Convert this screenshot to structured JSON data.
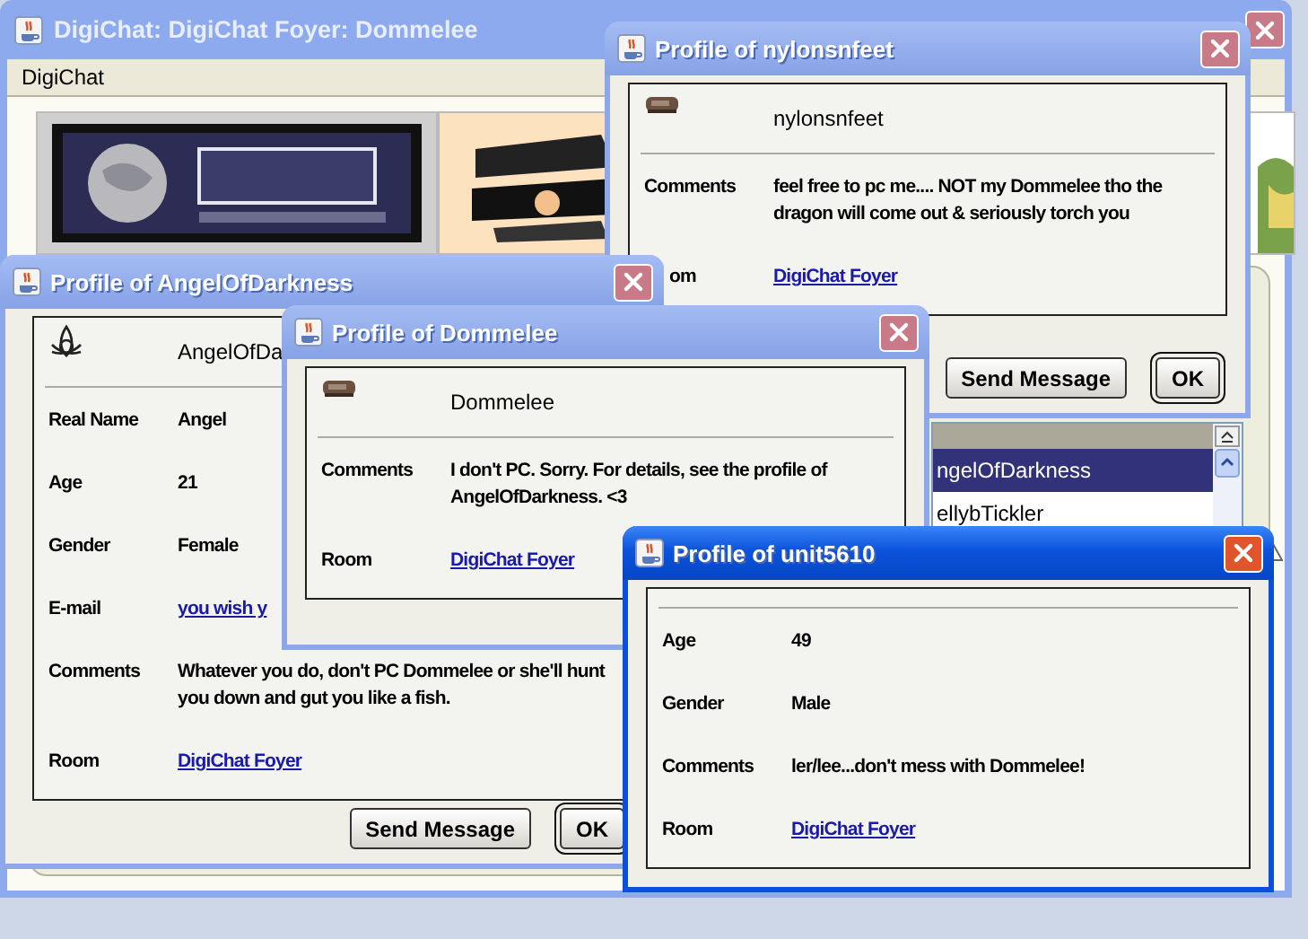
{
  "main_window": {
    "title": "DigiChat: DigiChat Foyer: Dommelee",
    "active": false,
    "menu": [
      {
        "label": "DigiChat"
      }
    ],
    "user_list": [
      {
        "name": "ngelOfDarkness",
        "selected": true
      },
      {
        "name": "ellybTickler",
        "selected": false
      }
    ]
  },
  "profile_windows": [
    {
      "title": "Profile of nylonsnfeet",
      "active": false,
      "avatar": {
        "kind": "thumbnail"
      },
      "username": "nylonsnfeet",
      "fields": [
        {
          "label": "Comments",
          "value": "feel free to pc me.... NOT my Dommelee tho the dragon will come out & seriously torch you",
          "kind": "text"
        },
        {
          "label": "om",
          "value": "DigiChat Foyer",
          "kind": "link"
        }
      ],
      "buttons": [
        {
          "label": "Send Message",
          "default": false
        },
        {
          "label": "OK",
          "default": true
        }
      ]
    },
    {
      "title": "Profile of AngelOfDarkness",
      "active": false,
      "avatar": {
        "kind": "triquetra"
      },
      "username": "AngelOfDa",
      "fields": [
        {
          "label": "Real Name",
          "value": "Angel",
          "kind": "text"
        },
        {
          "label": "Age",
          "value": "21",
          "kind": "text"
        },
        {
          "label": "Gender",
          "value": "Female",
          "kind": "text"
        },
        {
          "label": "E-mail",
          "value": "you wish y",
          "kind": "link"
        },
        {
          "label": "Comments",
          "value": "Whatever you do, don't PC Dommelee or she'll hunt you down and gut you like a fish.",
          "kind": "text"
        },
        {
          "label": "Room",
          "value": "DigiChat Foyer",
          "kind": "link"
        }
      ],
      "buttons": [
        {
          "label": "Send Message",
          "default": false
        },
        {
          "label": "OK",
          "default": true
        }
      ]
    },
    {
      "title": "Profile of Dommelee",
      "active": false,
      "avatar": {
        "kind": "thumbnail"
      },
      "username": "Dommelee",
      "fields": [
        {
          "label": "Comments",
          "value": "I don't PC. Sorry. For details, see the profile of AngelOfDarkness. <3",
          "kind": "text"
        },
        {
          "label": "Room",
          "value": "DigiChat Foyer",
          "kind": "link"
        }
      ]
    },
    {
      "title": "Profile of unit5610",
      "active": true,
      "fields": [
        {
          "label": "Age",
          "value": "49",
          "kind": "text"
        },
        {
          "label": "Gender",
          "value": "Male",
          "kind": "text"
        },
        {
          "label": "Comments",
          "value": "ler/lee...don't mess with Dommelee!",
          "kind": "text"
        },
        {
          "label": "Room",
          "value": "DigiChat Foyer",
          "kind": "link"
        }
      ]
    }
  ]
}
